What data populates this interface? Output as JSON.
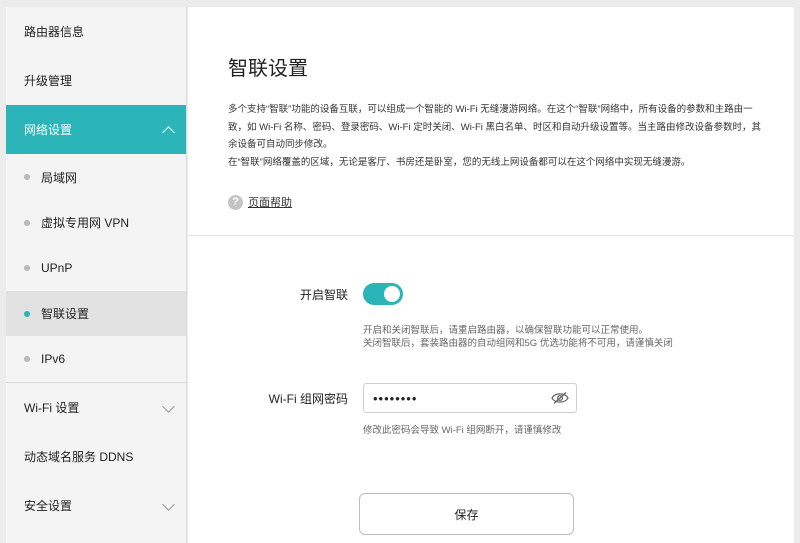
{
  "sidebar": {
    "items": [
      {
        "label": "路由器信息"
      },
      {
        "label": "升级管理"
      },
      {
        "label": "网络设置"
      },
      {
        "label": "局域网"
      },
      {
        "label": "虚拟专用网 VPN"
      },
      {
        "label": "UPnP"
      },
      {
        "label": "智联设置"
      },
      {
        "label": "IPv6"
      },
      {
        "label": "Wi-Fi 设置"
      },
      {
        "label": "动态域名服务 DDNS"
      },
      {
        "label": "安全设置"
      }
    ]
  },
  "main": {
    "title": "智联设置",
    "description": "多个支持“智联”功能的设备互联，可以组成一个智能的 Wi-Fi 无缝漫游网络。在这个“智联”网络中，所有设备的参数和主路由一致，如 Wi-Fi 名称、密码、登录密码、Wi-Fi 定时关闭、Wi-Fi 黑白名单、时区和自动升级设置等。当主路由修改设备参数时，其余设备可自动同步修改。\n在“智联”网络覆盖的区域，无论是客厅、书房还是卧室，您的无线上网设备都可以在这个网络中实现无缝漫游。",
    "help_icon_glyph": "?",
    "help_label": "页面帮助",
    "form": {
      "enable_label": "开启智联",
      "enable_state": true,
      "enable_hint": "开启和关闭智联后，请重启路由器，以确保智联功能可以正常使用。\n关闭智联后，套装路由器的自动组网和5G 优选功能将不可用，请谨慎关闭",
      "password_label": "Wi-Fi 组网密码",
      "password_value": "••••••••",
      "password_hint": "修改此密码会导致 Wi-Fi 组网断开，请谨慎修改"
    },
    "save_label": "保存"
  },
  "colors": {
    "accent": "#2bb5b9",
    "sidebar_bg": "#f4f4f4",
    "active_sub_bg": "#e2e2e2"
  },
  "icons": [
    "chevron-up-icon",
    "chevron-down-icon",
    "help-icon",
    "eye-icon"
  ]
}
